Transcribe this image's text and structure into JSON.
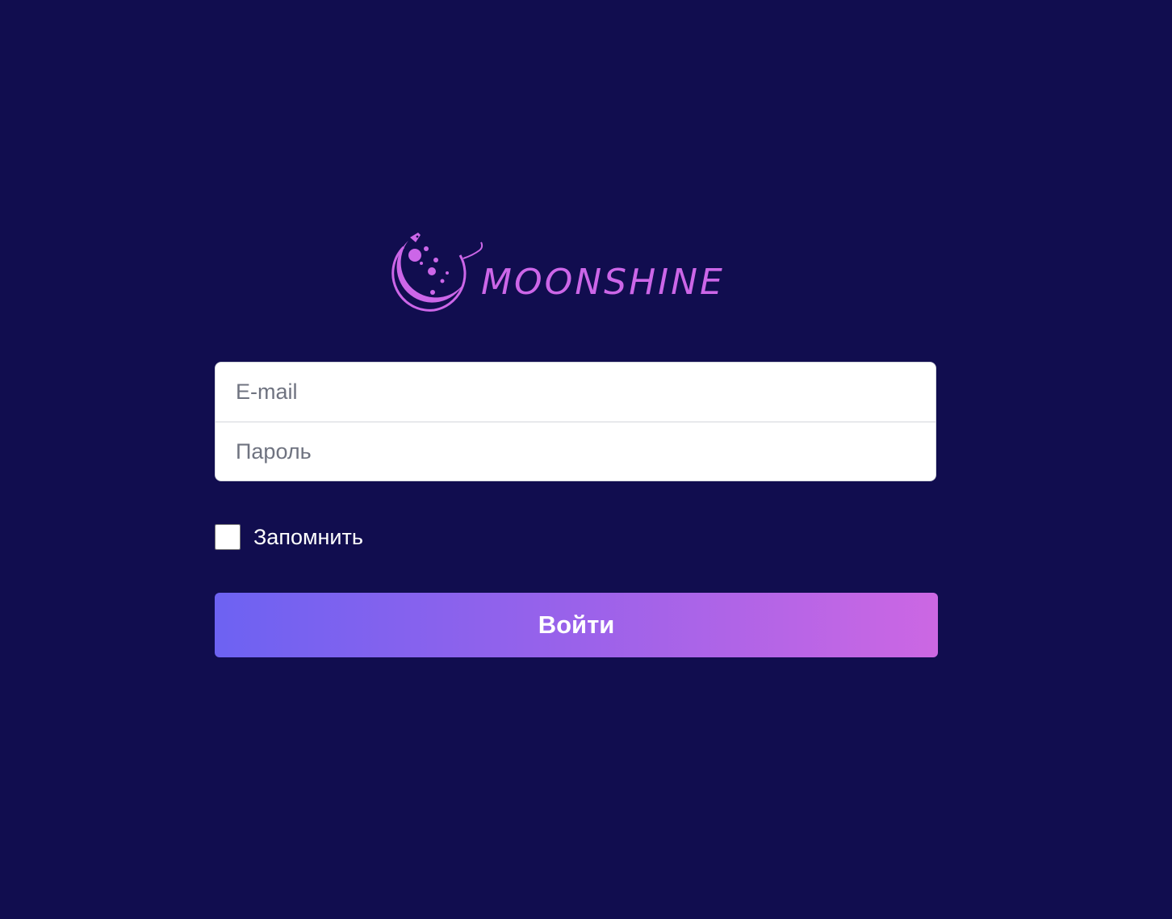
{
  "brand": {
    "name": "MOONSHINE",
    "logo_icon": "moon-rocket-icon",
    "color": "#cc66e8"
  },
  "login_form": {
    "email_placeholder": "E-mail",
    "password_placeholder": "Пароль",
    "remember_label": "Запомнить",
    "remember_checked": false,
    "submit_label": "Войти"
  },
  "colors": {
    "background": "#110d4f",
    "button_gradient_start": "#6d62f2",
    "button_gradient_end": "#cc67e3"
  }
}
